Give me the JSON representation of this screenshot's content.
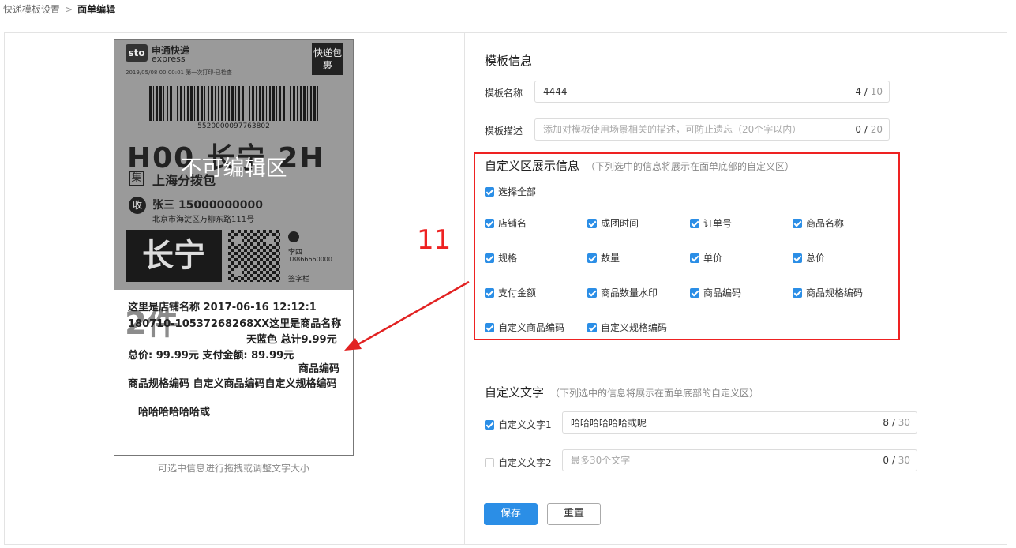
{
  "breadcrumb": {
    "parent": "快递模板设置",
    "separator": ">",
    "current": "面单编辑"
  },
  "preview": {
    "logo": "sto",
    "brand_name": "申通快递",
    "brand_en": "express",
    "print_date": "2019/05/08  00:00:01  第一次打印-已检查",
    "tag": "快递包裹",
    "barcode_number": "5520000097763802",
    "route_code": "H00 长宁 2H",
    "non_editable_label": "不可编辑区",
    "hub_icon": "集",
    "hub": "上海分拨包",
    "recv_icon": "收",
    "receiver": "张三  15000000000",
    "address": "北京市海淀区万柳东路111号",
    "district": "长宁",
    "sender": "李四",
    "sender_phone": "18866660000",
    "sign": "签字栏",
    "custom_lines": {
      "store_time": "这里是店铺名称 2017-06-16 12:12:1",
      "order_item": "180710-10537268268XX这里是商品名称",
      "spec_total": "天蓝色  总计9.99元",
      "price_pay": "总价: 99.99元  支付金额: 89.99元",
      "sku_code": "商品编码",
      "spec_codes": "商品规格编码  自定义商品编码自定义规格编码",
      "custom_text": "哈哈哈哈哈哈或"
    },
    "qty_watermark": "2件",
    "hint": "可选中信息进行拖拽或调整文字大小"
  },
  "annotation": {
    "number": "11"
  },
  "template_info": {
    "title": "模板信息",
    "name_label": "模板名称",
    "name_value": "4444",
    "name_count": "4",
    "name_max": "10",
    "desc_label": "模板描述",
    "desc_placeholder": "添加对模板使用场景相关的描述，可防止遗忘（20个字以内）",
    "desc_count": "0",
    "desc_max": "20"
  },
  "custom_area": {
    "title": "自定义区展示信息",
    "subtitle": "（下列选中的信息将展示在面单底部的自定义区）",
    "select_all": "选择全部",
    "options": [
      "店铺名",
      "成团时间",
      "订单号",
      "商品名称",
      "规格",
      "数量",
      "单价",
      "总价",
      "支付金额",
      "商品数量水印",
      "商品编码",
      "商品规格编码",
      "自定义商品编码",
      "自定义规格编码"
    ]
  },
  "custom_text": {
    "title": "自定义文字",
    "subtitle": "（下列选中的信息将展示在面单底部的自定义区）",
    "text1_label": "自定义文字1",
    "text1_value": "哈哈哈哈哈哈或呢",
    "text1_count": "8",
    "text1_max": "30",
    "text2_label": "自定义文字2",
    "text2_placeholder": "最多30个文字",
    "text2_count": "0",
    "text2_max": "30"
  },
  "actions": {
    "save": "保存",
    "reset": "重置"
  },
  "colors": {
    "primary": "#2b8ee6",
    "annotation": "#e22222"
  }
}
